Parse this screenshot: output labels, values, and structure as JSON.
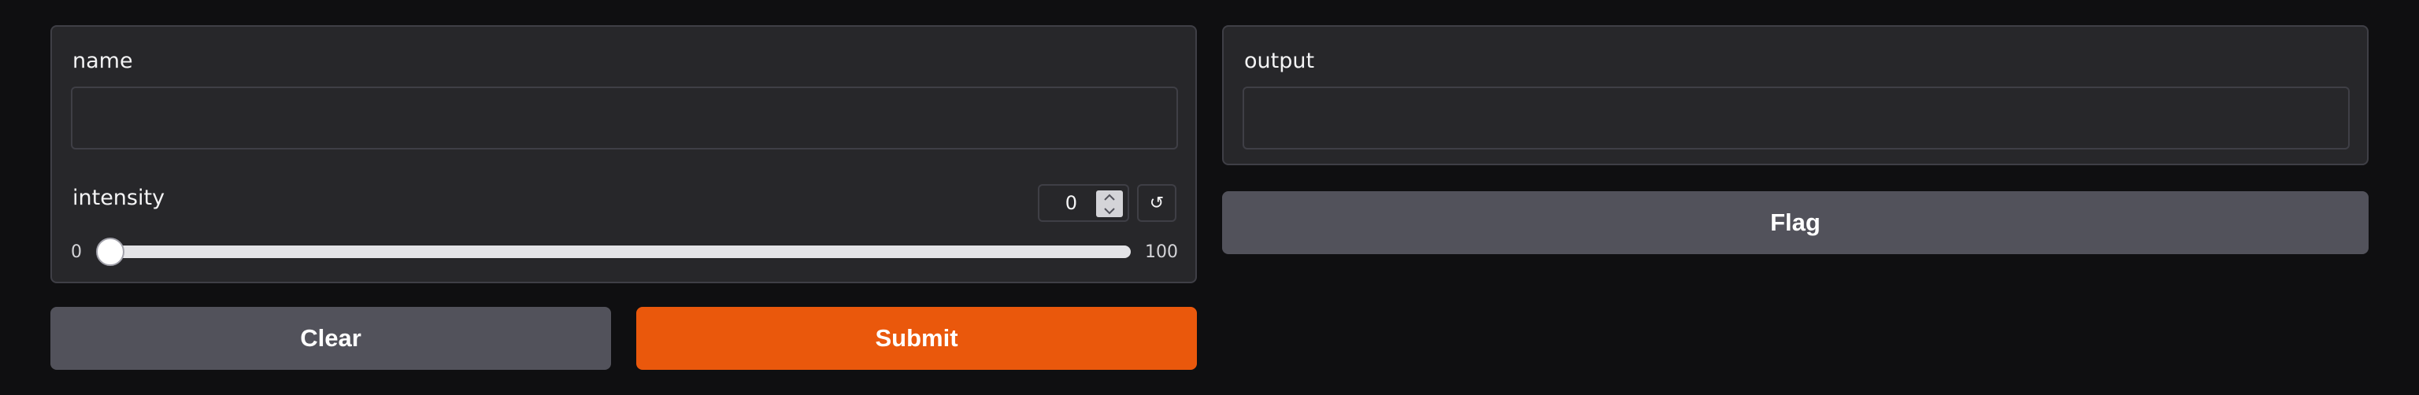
{
  "inputs": {
    "name": {
      "label": "name",
      "value": ""
    },
    "intensity": {
      "label": "intensity",
      "value": "0",
      "min_label": "0",
      "max_label": "100",
      "level": 0,
      "reset_icon": "↺"
    }
  },
  "outputs": {
    "output": {
      "label": "output",
      "value": ""
    }
  },
  "buttons": {
    "clear": "Clear",
    "submit": "Submit",
    "flag": "Flag"
  },
  "colors": {
    "background": "#0f0f11",
    "panel": "#27272a",
    "border": "#3f3f46",
    "secondary_button": "#52525b",
    "primary_button": "#ea580c"
  },
  "icons": {
    "spin_up": "chevron-up-icon",
    "spin_down": "chevron-down-icon",
    "reset": "reset-icon"
  }
}
